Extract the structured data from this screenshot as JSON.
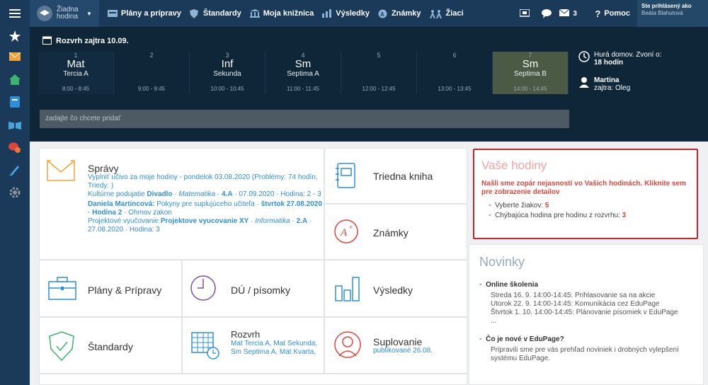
{
  "topbar": {
    "hour_label": "Žiadna hodina",
    "nav": [
      "Plány a prípravy",
      "Štandardy",
      "Moja knižnica",
      "Výsledky",
      "Známky",
      "Žiaci"
    ],
    "mail_count": "3",
    "help": "Pomoc",
    "login_line1": "Ste prihlásený ako",
    "login_line2": "Beáta Blahutová"
  },
  "timetable": {
    "title": "Rozvrh zajtra 10.09.",
    "slots": [
      {
        "num": "1",
        "subject": "Mat",
        "class": "Tercia A",
        "time": "8:00 - 8:45"
      },
      {
        "num": "2",
        "subject": "",
        "class": "",
        "time": "9:00 - 9:45"
      },
      {
        "num": "3",
        "subject": "Inf",
        "class": "Sekunda",
        "time": "10:00 - 10:45"
      },
      {
        "num": "4",
        "subject": "Sm",
        "class": "Septima A",
        "time": "11:00 - 11:45"
      },
      {
        "num": "5",
        "subject": "",
        "class": "",
        "time": "12:00 - 12:45"
      },
      {
        "num": "6",
        "subject": "",
        "class": "",
        "time": "13:00 - 13:45"
      },
      {
        "num": "7",
        "subject": "Sm",
        "class": "Septima B",
        "time": "14:00 - 14:45"
      }
    ],
    "side_line1": "Hurá domov. Zvoní o:",
    "side_line2": "18 hodín",
    "person_name": "Martina",
    "person_next": "zajtra: Oleg",
    "add_placeholder": "zadajte čo chcete pridať"
  },
  "tiles": {
    "spravy": {
      "label": "Správy",
      "m1": "Vyplniť učivo za moje hodiny - pondelok 03.08.2020 (Problémy: 74 hodín, Triedy: )",
      "m2a": "Kultúrne podujatie ",
      "m2b": "Divadlo",
      "m2c": " · ",
      "m2d": "Matematika",
      "m2e": " · ",
      "m2f": "4.A",
      "m2g": " · 07.09.2020 · Hodina: 2 - 3",
      "m3a": "Daniela Martincová:",
      "m3b": " Pokyny pre suplujúceho učiteľa · ",
      "m3c": "štvrtok 27.08.2020 · Hodina 2",
      "m3d": " · Ohmov zakon",
      "m4a": "Projektové vyučovanie ",
      "m4b": "Projektove vyucovanie XY",
      "m4c": " · ",
      "m4d": "Informatika",
      "m4e": " · ",
      "m4f": "2.A",
      "m4g": " · 27.08.2020 · Hodina: 3"
    },
    "triedna": "Triedna kniha",
    "znamky": "Známky",
    "plany": "Plány & Prípravy",
    "du": "DÚ / písomky",
    "vysledky": "Výsledky",
    "standardy": "Štandardy",
    "rozvrh": "Rozvrh",
    "rozvrh_sub": "Mat Tercia A, Mat Sekunda, Sm Septima A, Mat Kvarta,",
    "suplovanie": "Suplovanie",
    "suplovanie_sub": "publikované 26.08."
  },
  "hodiny": {
    "title": "Vaše hodiny",
    "warn": "Našli sme zopár nejasností vo Vašich hodinách. Kliknite sem pre zobrazenie detailov",
    "item1": "Vyberte žiakov: ",
    "item1_val": "5",
    "item2": "Chýbajúca hodina pre hodinu z rozvrhu: ",
    "item2_val": "3"
  },
  "novinky": {
    "title": "Novinky",
    "a_title": "Online školenia",
    "a1": "Streda 16. 9. 14:00-14:45: Prihlasovanie sa na akcie",
    "a2": "Utorok 22. 9. 14:00-14:45: Komunikácia cez EduPage",
    "a3": "Štvrtok 1. 10. 14:00-14:45: Plánovanie písomiek v EduPage",
    "a4": "...",
    "b_title": "Čo je nové v EduPage?",
    "b1": "Pripravili sme pre vás prehľad noviniek i drobných vylepšení systému EduPage."
  }
}
